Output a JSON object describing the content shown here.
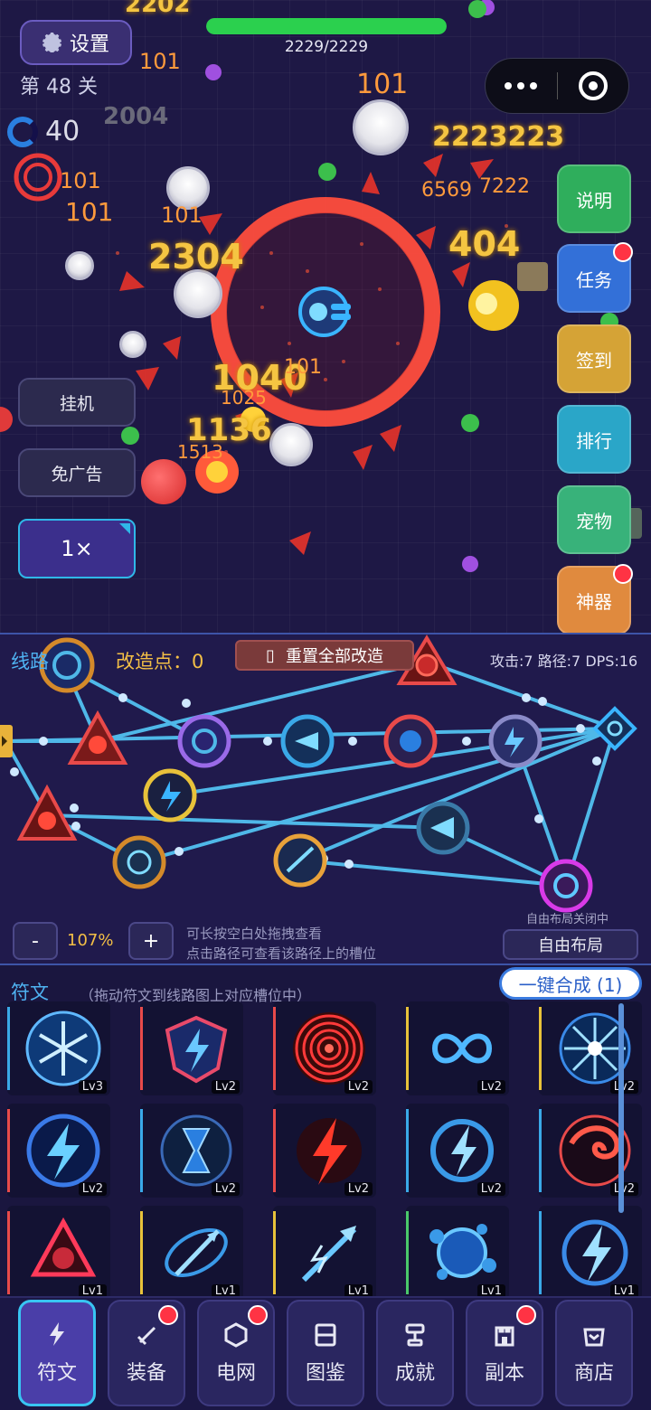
{
  "hud": {
    "settings_label": "设置",
    "level_label": "第 48 关",
    "hp_text": "2229/2229",
    "hp_fraction": 1.0,
    "timer_value": "40"
  },
  "side_menu": [
    {
      "label": "说明",
      "color": "#2fae5c",
      "badge": false
    },
    {
      "label": "任务",
      "color": "#3370d8",
      "badge": true
    },
    {
      "label": "签到",
      "color": "#d5a336",
      "badge": false
    },
    {
      "label": "排行",
      "color": "#2aa6c8",
      "badge": false
    },
    {
      "label": "宠物",
      "color": "#38b27a",
      "badge": false
    },
    {
      "label": "神器",
      "color": "#e08a3e",
      "badge": true
    }
  ],
  "left_menu": {
    "idle_label": "挂机",
    "noad_label": "免广告",
    "speed_label": "1×"
  },
  "damage_numbers": [
    "2202",
    "101",
    "101",
    "101",
    "101",
    "40",
    "2004",
    "2223223",
    "6569",
    "7222",
    "404",
    "101",
    "2304",
    "1040",
    "101",
    "1136",
    "1513",
    "1025"
  ],
  "route": {
    "title": "线路",
    "mod_points": "改造点：0",
    "reset_label": "重置全部改造",
    "stats": "攻击:7 路径:7 DPS:16",
    "zoom": "107%",
    "zoom_minus": "-",
    "zoom_plus": "+",
    "hint_1": "可长按空白处拖拽查看",
    "hint_2": "点击路径可查看该路径上的槽位",
    "layout_off": "自由布局关闭中",
    "layout_btn": "自由布局"
  },
  "runes": {
    "title": "符文",
    "hint": "（拖动符文到线路图上对应槽位中）",
    "merge_label": "一键合成 (1)",
    "items": [
      {
        "icon": "snowflake",
        "lv": "Lv3",
        "accent": "#3aa9e8"
      },
      {
        "icon": "shield-bolt",
        "lv": "Lv2",
        "accent": "#e84a4a"
      },
      {
        "icon": "ripple",
        "lv": "Lv2",
        "accent": "#e84a4a"
      },
      {
        "icon": "infinity",
        "lv": "Lv2",
        "accent": "#e8c23a"
      },
      {
        "icon": "burst",
        "lv": "Lv2",
        "accent": "#e8c23a"
      },
      {
        "icon": "bolt-circle",
        "lv": "Lv2",
        "accent": "#e84a4a"
      },
      {
        "icon": "hourglass",
        "lv": "Lv2",
        "accent": "#3aa9e8"
      },
      {
        "icon": "red-bolt",
        "lv": "Lv2",
        "accent": "#e84a4a"
      },
      {
        "icon": "swirl-bolt",
        "lv": "Lv2",
        "accent": "#3aa9e8"
      },
      {
        "icon": "dragon",
        "lv": "Lv2",
        "accent": "#3aa9e8"
      },
      {
        "icon": "triangle-shuriken",
        "lv": "Lv1",
        "accent": "#e84a4a"
      },
      {
        "icon": "arrow-orbit",
        "lv": "Lv1",
        "accent": "#e8c23a"
      },
      {
        "icon": "arrow-bolt",
        "lv": "Lv1",
        "accent": "#e8c23a"
      },
      {
        "icon": "orbs",
        "lv": "Lv1",
        "accent": "#4ac86a"
      },
      {
        "icon": "storm-bolt",
        "lv": "Lv1",
        "accent": "#3aa9e8"
      }
    ]
  },
  "nav": [
    {
      "label": "符文",
      "icon": "bolt-icon",
      "active": true,
      "badge": false
    },
    {
      "label": "装备",
      "icon": "sword-icon",
      "active": false,
      "badge": true
    },
    {
      "label": "电网",
      "icon": "hexagon-icon",
      "active": false,
      "badge": true
    },
    {
      "label": "图鉴",
      "icon": "book-icon",
      "active": false,
      "badge": false
    },
    {
      "label": "成就",
      "icon": "trophy-icon",
      "active": false,
      "badge": false
    },
    {
      "label": "副本",
      "icon": "castle-icon",
      "active": false,
      "badge": true
    },
    {
      "label": "商店",
      "icon": "shop-bag-icon",
      "active": false,
      "badge": false
    }
  ]
}
